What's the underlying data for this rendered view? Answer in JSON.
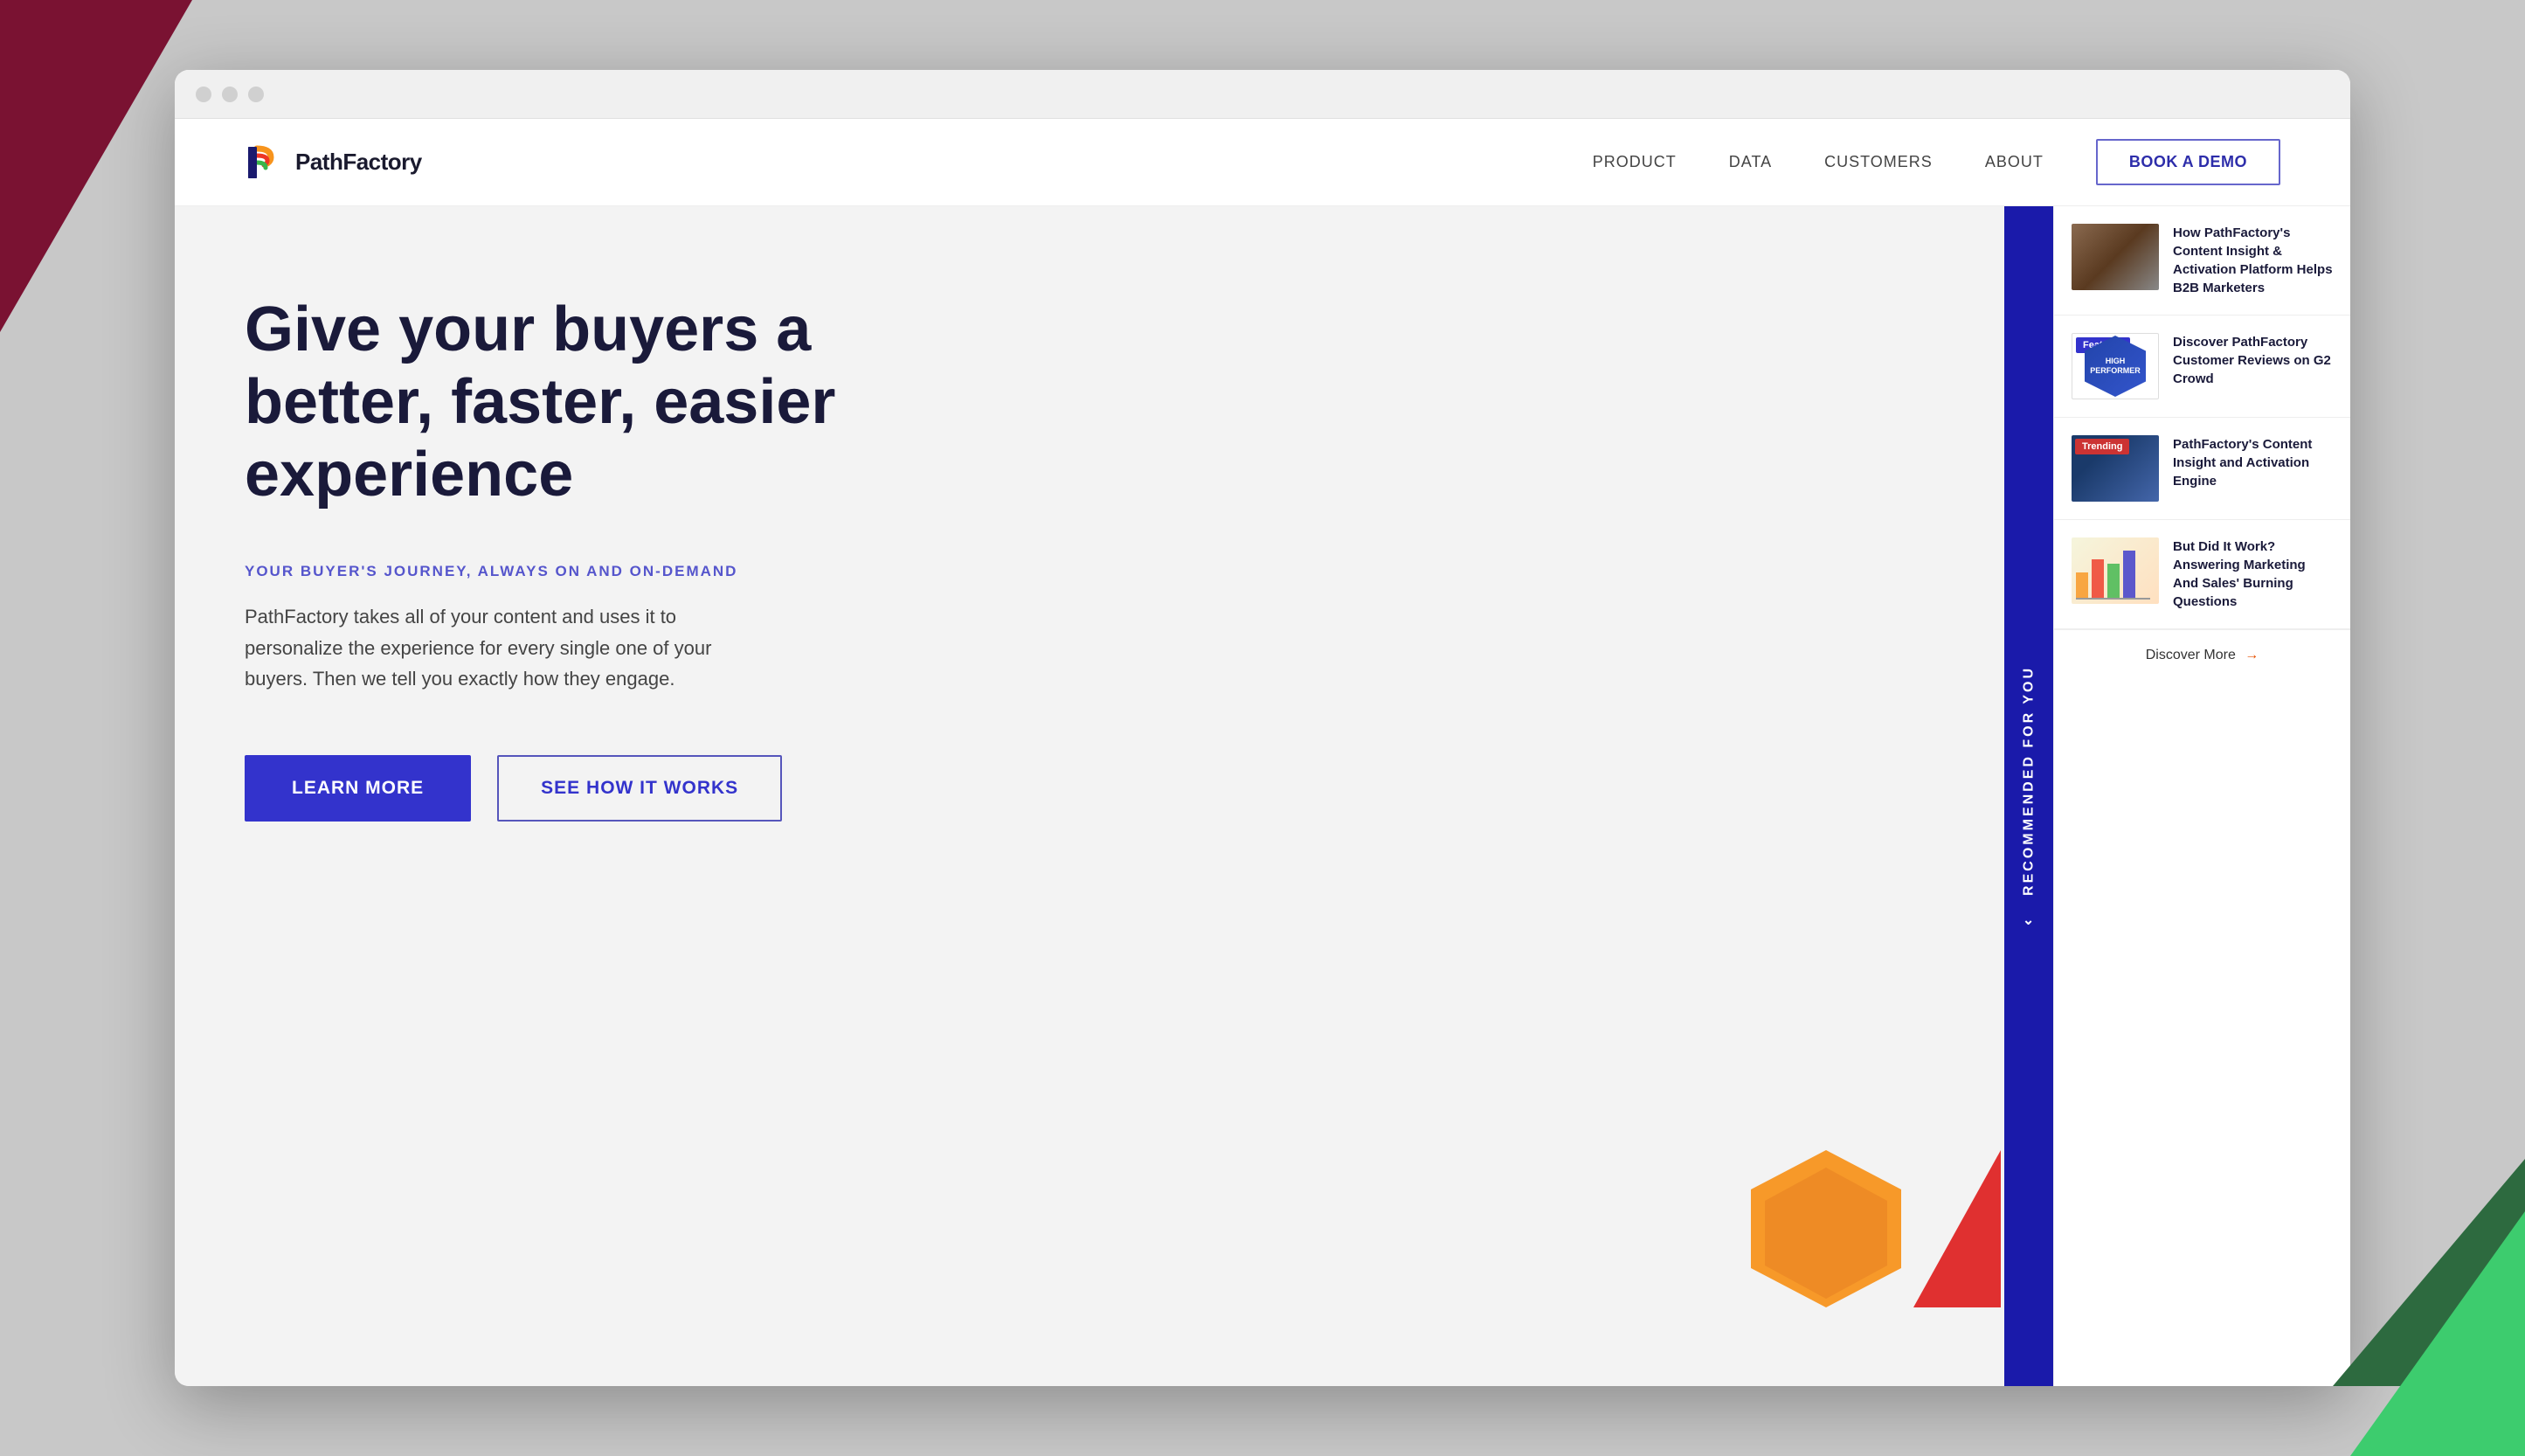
{
  "browser": {
    "dots": [
      "dot1",
      "dot2",
      "dot3"
    ]
  },
  "header": {
    "logo_text": "PathFactory",
    "nav": {
      "items": [
        {
          "label": "PRODUCT",
          "id": "product"
        },
        {
          "label": "DATA",
          "id": "data"
        },
        {
          "label": "CUSTOMERS",
          "id": "customers"
        },
        {
          "label": "ABOUT",
          "id": "about"
        }
      ],
      "book_demo": "BOOK A DEMO"
    }
  },
  "hero": {
    "title": "Give your buyers a better, faster, easier experience",
    "subtitle": "YOUR BUYER'S JOURNEY, ALWAYS ON AND ON-DEMAND",
    "body": "PathFactory takes all of your content and uses it to personalize the experience for every single one of your buyers. Then we tell you exactly how they engage.",
    "btn_primary": "LEARN MORE",
    "btn_secondary": "SEE HOW IT WORKS"
  },
  "recommended": {
    "sidebar_label": "RECOMMENDED FOR YOU",
    "cards": [
      {
        "title": "How PathFactory's Content Insight & Activation Platform Helps B2B Marketers",
        "thumb_type": "photo",
        "badge": null
      },
      {
        "title": "Discover PathFactory Customer Reviews on G2 Crowd",
        "thumb_type": "badge",
        "badge": "Featured"
      },
      {
        "title": "PathFactory's Content Insight and Activation Engine",
        "thumb_type": "dark",
        "badge": "Trending"
      },
      {
        "title": "But Did It Work? Answering Marketing And Sales' Burning Questions",
        "thumb_type": "chart",
        "badge": null
      }
    ],
    "discover_more": "Discover More",
    "discover_arrow": "→"
  }
}
